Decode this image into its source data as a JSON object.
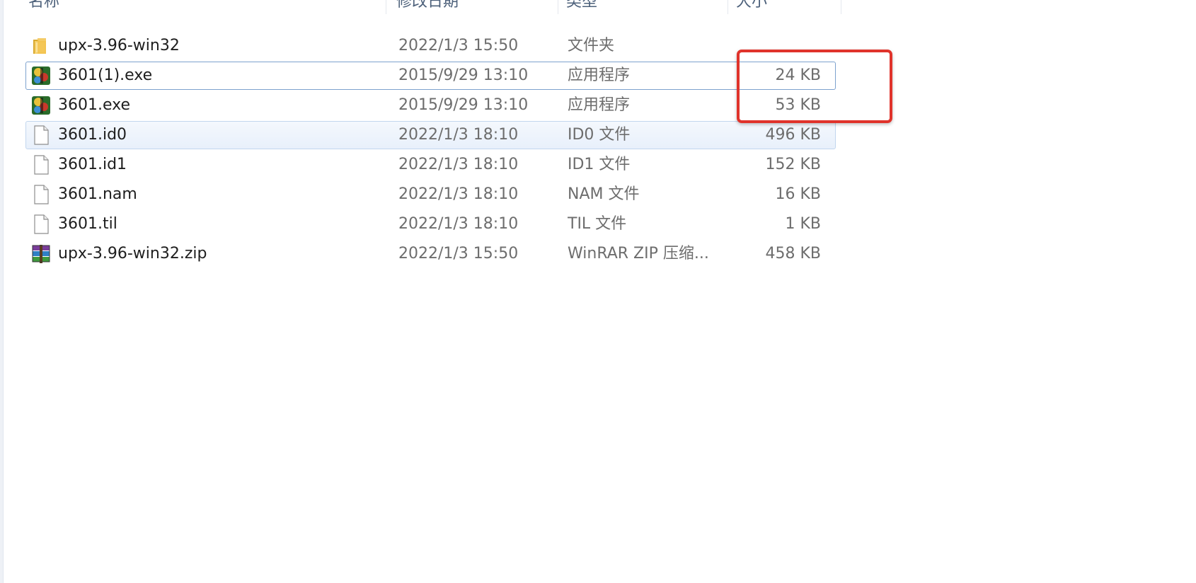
{
  "columns": {
    "name": "名称",
    "date": "修改日期",
    "type": "类型",
    "size": "大小"
  },
  "files": [
    {
      "name": "upx-3.96-win32",
      "date": "2022/1/3 15:50",
      "type": "文件夹",
      "size": "",
      "icon": "folder-icon"
    },
    {
      "name": "3601(1).exe",
      "date": "2015/9/29 13:10",
      "type": "应用程序",
      "size": "24 KB",
      "icon": "exe-app-icon"
    },
    {
      "name": "3601.exe",
      "date": "2015/9/29 13:10",
      "type": "应用程序",
      "size": "53 KB",
      "icon": "exe-app-icon"
    },
    {
      "name": "3601.id0",
      "date": "2022/1/3 18:10",
      "type": "ID0 文件",
      "size": "496 KB",
      "icon": "blank-file-icon"
    },
    {
      "name": "3601.id1",
      "date": "2022/1/3 18:10",
      "type": "ID1 文件",
      "size": "152 KB",
      "icon": "blank-file-icon"
    },
    {
      "name": "3601.nam",
      "date": "2022/1/3 18:10",
      "type": "NAM 文件",
      "size": "16 KB",
      "icon": "blank-file-icon"
    },
    {
      "name": "3601.til",
      "date": "2022/1/3 18:10",
      "type": "TIL 文件",
      "size": "1 KB",
      "icon": "blank-file-icon"
    },
    {
      "name": "upx-3.96-win32.zip",
      "date": "2022/1/3 15:50",
      "type": "WinRAR ZIP 压缩...",
      "size": "458 KB",
      "icon": "winrar-archive-icon"
    }
  ],
  "colors": {
    "annotation_box": "#e0332b",
    "selection_border": "#7da2ce",
    "hover_background": "#e8f0fb"
  }
}
